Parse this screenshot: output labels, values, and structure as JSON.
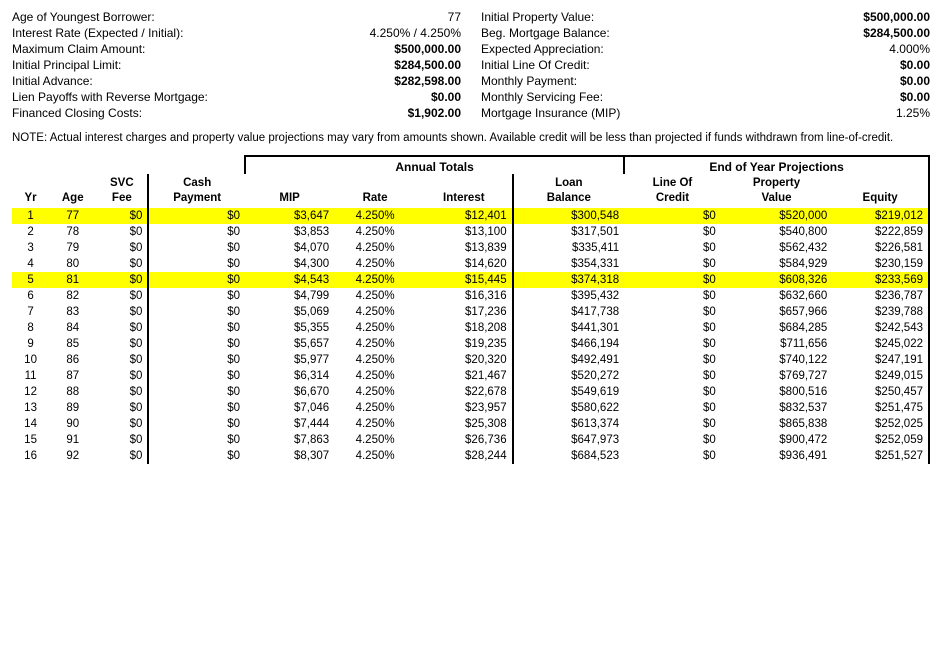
{
  "summary": {
    "left": [
      {
        "label": "Age of Youngest Borrower:",
        "value": "77",
        "bold": false
      },
      {
        "label": "Interest Rate (Expected / Initial):",
        "value": "4.250%  /  4.250%",
        "bold": false
      },
      {
        "label": "Maximum Claim Amount:",
        "value": "$500,000.00",
        "bold": true
      },
      {
        "label": "Initial Principal Limit:",
        "value": "$284,500.00",
        "bold": true
      },
      {
        "label": "Initial Advance:",
        "value": "$282,598.00",
        "bold": true
      },
      {
        "label": "Lien Payoffs with Reverse Mortgage:",
        "value": "$0.00",
        "bold": true
      },
      {
        "label": "Financed Closing Costs:",
        "value": "$1,902.00",
        "bold": true
      }
    ],
    "right": [
      {
        "label": "Initial Property Value:",
        "value": "$500,000.00",
        "bold": true
      },
      {
        "label": "Beg. Mortgage Balance:",
        "value": "$284,500.00",
        "bold": true
      },
      {
        "label": "Expected Appreciation:",
        "value": "4.000%",
        "bold": false
      },
      {
        "label": "Initial Line Of Credit:",
        "value": "$0.00",
        "bold": true
      },
      {
        "label": "Monthly Payment:",
        "value": "$0.00",
        "bold": true
      },
      {
        "label": "Monthly Servicing Fee:",
        "value": "$0.00",
        "bold": true
      },
      {
        "label": "Mortgage Insurance (MIP)",
        "value": "1.25%",
        "bold": false
      }
    ]
  },
  "note": "NOTE:  Actual interest charges and property value projections may vary from amounts shown.  Available credit will be less than projected if funds withdrawn from line-of-credit.",
  "table": {
    "annual_totals_label": "Annual Totals",
    "eoy_label": "End of Year Projections",
    "headers": {
      "yr": "Yr",
      "age": "Age",
      "svc_fee": "SVC Fee",
      "cash_payment": "Cash Payment",
      "mip": "MIP",
      "rate": "Rate",
      "interest": "Interest",
      "loan_balance": "Loan Balance",
      "line_of_credit": "Line Of Credit",
      "property_value": "Property Value",
      "equity": "Equity"
    },
    "rows": [
      {
        "yr": 1,
        "age": 77,
        "svc": "$0",
        "cash": "$0",
        "mip": "$3,647",
        "rate": "4.250%",
        "interest": "$12,401",
        "loan": "$300,548",
        "loc": "$0",
        "prop": "$520,000",
        "equity": "$219,012",
        "highlight": "yellow"
      },
      {
        "yr": 2,
        "age": 78,
        "svc": "$0",
        "cash": "$0",
        "mip": "$3,853",
        "rate": "4.250%",
        "interest": "$13,100",
        "loan": "$317,501",
        "loc": "$0",
        "prop": "$540,800",
        "equity": "$222,859"
      },
      {
        "yr": 3,
        "age": 79,
        "svc": "$0",
        "cash": "$0",
        "mip": "$4,070",
        "rate": "4.250%",
        "interest": "$13,839",
        "loan": "$335,411",
        "loc": "$0",
        "prop": "$562,432",
        "equity": "$226,581"
      },
      {
        "yr": 4,
        "age": 80,
        "svc": "$0",
        "cash": "$0",
        "mip": "$4,300",
        "rate": "4.250%",
        "interest": "$14,620",
        "loan": "$354,331",
        "loc": "$0",
        "prop": "$584,929",
        "equity": "$230,159"
      },
      {
        "yr": 5,
        "age": 81,
        "svc": "$0",
        "cash": "$0",
        "mip": "$4,543",
        "rate": "4.250%",
        "interest": "$15,445",
        "loan": "$374,318",
        "loc": "$0",
        "prop": "$608,326",
        "equity": "$233,569",
        "highlight": "yellow"
      },
      {
        "yr": 6,
        "age": 82,
        "svc": "$0",
        "cash": "$0",
        "mip": "$4,799",
        "rate": "4.250%",
        "interest": "$16,316",
        "loan": "$395,432",
        "loc": "$0",
        "prop": "$632,660",
        "equity": "$236,787"
      },
      {
        "yr": 7,
        "age": 83,
        "svc": "$0",
        "cash": "$0",
        "mip": "$5,069",
        "rate": "4.250%",
        "interest": "$17,236",
        "loan": "$417,738",
        "loc": "$0",
        "prop": "$657,966",
        "equity": "$239,788"
      },
      {
        "yr": 8,
        "age": 84,
        "svc": "$0",
        "cash": "$0",
        "mip": "$5,355",
        "rate": "4.250%",
        "interest": "$18,208",
        "loan": "$441,301",
        "loc": "$0",
        "prop": "$684,285",
        "equity": "$242,543"
      },
      {
        "yr": 9,
        "age": 85,
        "svc": "$0",
        "cash": "$0",
        "mip": "$5,657",
        "rate": "4.250%",
        "interest": "$19,235",
        "loan": "$466,194",
        "loc": "$0",
        "prop": "$711,656",
        "equity": "$245,022"
      },
      {
        "yr": 10,
        "age": 86,
        "svc": "$0",
        "cash": "$0",
        "mip": "$5,977",
        "rate": "4.250%",
        "interest": "$20,320",
        "loan": "$492,491",
        "loc": "$0",
        "prop": "$740,122",
        "equity": "$247,191"
      },
      {
        "yr": 11,
        "age": 87,
        "svc": "$0",
        "cash": "$0",
        "mip": "$6,314",
        "rate": "4.250%",
        "interest": "$21,467",
        "loan": "$520,272",
        "loc": "$0",
        "prop": "$769,727",
        "equity": "$249,015"
      },
      {
        "yr": 12,
        "age": 88,
        "svc": "$0",
        "cash": "$0",
        "mip": "$6,670",
        "rate": "4.250%",
        "interest": "$22,678",
        "loan": "$549,619",
        "loc": "$0",
        "prop": "$800,516",
        "equity": "$250,457"
      },
      {
        "yr": 13,
        "age": 89,
        "svc": "$0",
        "cash": "$0",
        "mip": "$7,046",
        "rate": "4.250%",
        "interest": "$23,957",
        "loan": "$580,622",
        "loc": "$0",
        "prop": "$832,537",
        "equity": "$251,475"
      },
      {
        "yr": 14,
        "age": 90,
        "svc": "$0",
        "cash": "$0",
        "mip": "$7,444",
        "rate": "4.250%",
        "interest": "$25,308",
        "loan": "$613,374",
        "loc": "$0",
        "prop": "$865,838",
        "equity": "$252,025"
      },
      {
        "yr": 15,
        "age": 91,
        "svc": "$0",
        "cash": "$0",
        "mip": "$7,863",
        "rate": "4.250%",
        "interest": "$26,736",
        "loan": "$647,973",
        "loc": "$0",
        "prop": "$900,472",
        "equity": "$252,059"
      },
      {
        "yr": 16,
        "age": 92,
        "svc": "$0",
        "cash": "$0",
        "mip": "$8,307",
        "rate": "4.250%",
        "interest": "$28,244",
        "loan": "$684,523",
        "loc": "$0",
        "prop": "$936,491",
        "equity": "$251,527"
      }
    ]
  }
}
